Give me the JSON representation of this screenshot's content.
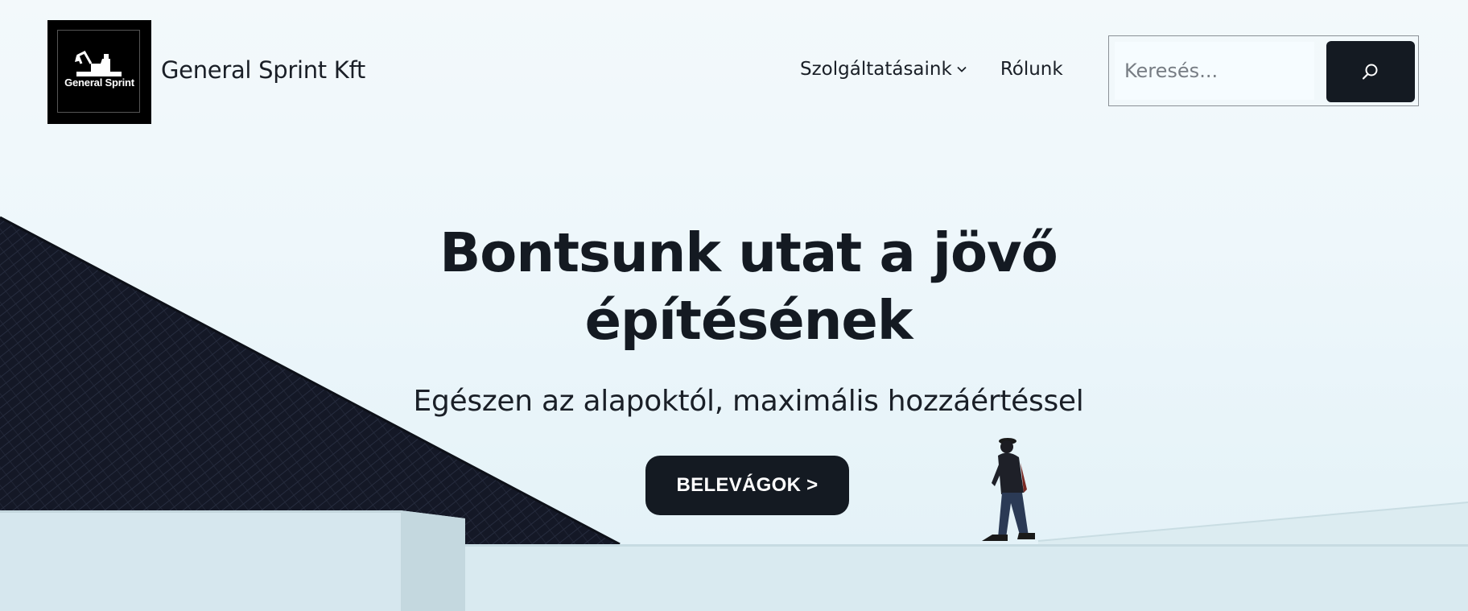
{
  "brand": {
    "logo_text": "General Sprint",
    "site_title": "General Sprint Kft"
  },
  "nav": {
    "items": [
      {
        "label": "Szolgáltatásaink",
        "has_dropdown": true
      },
      {
        "label": "Rólunk",
        "has_dropdown": false
      }
    ]
  },
  "search": {
    "placeholder": "Keresés...",
    "icon": "search-icon"
  },
  "hero": {
    "headline_line1": "Bontsunk utat a jövő",
    "headline_line2": "építésének",
    "subtitle": "Egészen az alapoktól, maximális hozzáértéssel",
    "cta_label": "BELEVÁGOK >"
  },
  "colors": {
    "dark": "#141a22",
    "sky": "#eef7fb"
  }
}
